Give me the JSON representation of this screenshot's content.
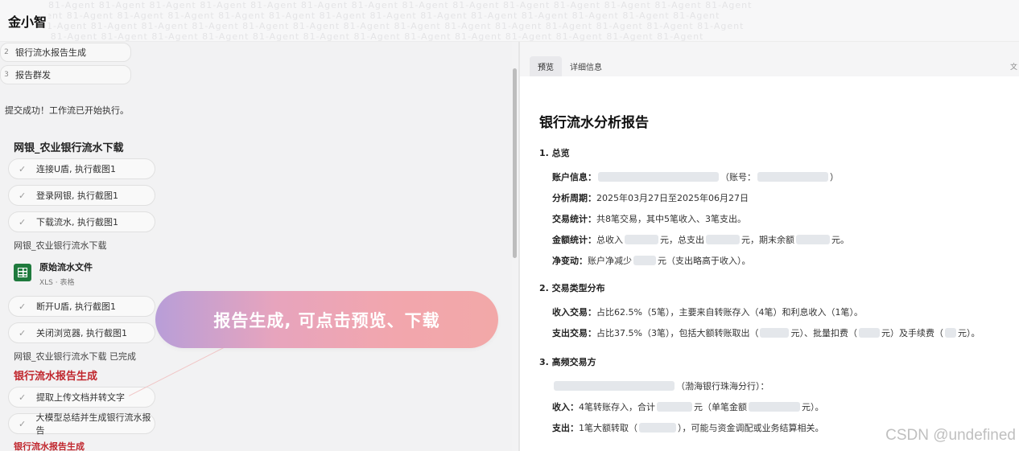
{
  "app": {
    "title": "金小智"
  },
  "watermark": {
    "text": "81-Agent 81-Agent 81-Agent 81-Agent 81-Agent 81-Agent 81-Agent 81-Agent 81-Agent 81-Agent 81-Agent 81-Agent 81-Agent 81-Agent"
  },
  "left": {
    "numbered_steps": [
      {
        "num": "2",
        "label": "银行流水报告生成"
      },
      {
        "num": "3",
        "label": "报告群发"
      }
    ],
    "submit_msg": "提交成功！工作流已开始执行。",
    "section1_title": "网银_农业银行流水下载",
    "section1_steps": [
      "连接U盾, 执行截图1",
      "登录网银, 执行截图1",
      "下载流水, 执行截图1"
    ],
    "section1_label": "网银_农业银行流水下载",
    "file": {
      "name": "原始流水文件",
      "type": "XLS · 表格"
    },
    "section1_steps_b": [
      "断开U盾, 执行截图1",
      "关闭浏览器, 执行截图1"
    ],
    "section1_done": "网银_农业银行流水下载 已完成",
    "section2_title": "银行流水报告生成",
    "section2_steps": [
      "提取上传文档并转文字",
      "大模型总结并生成银行流水报告"
    ],
    "section2_label": "银行流水报告生成",
    "check_icon": "check-icon",
    "file_icon": "spreadsheet-icon"
  },
  "banner": {
    "text": "报告生成, 可点击预览、下载"
  },
  "right": {
    "tabs": [
      "预览",
      "详细信息"
    ],
    "active_tab": "预览",
    "corner": "文",
    "report": {
      "title": "银行流水分析报告",
      "s1": "1. 总览",
      "account_label": "账户信息：",
      "account_no_label": "（账号：",
      "account_no_end": "）",
      "period_label": "分析周期：",
      "period_value": "2025年03月27日至2025年06月27日",
      "tx_label": "交易统计：",
      "tx_value": "共8笔交易，其中5笔收入、3笔支出。",
      "amt_label": "金额统计：",
      "amt_a": "总收入",
      "amt_b": "元，总支出",
      "amt_c": "元，期末余额",
      "amt_d": "元。",
      "net_label": "净变动：",
      "net_a": "账户净减少",
      "net_b": "元（支出略高于收入）。",
      "s2": "2. 交易类型分布",
      "in_label": "收入交易：",
      "in_value": "占比62.5%（5笔），主要来自转账存入（4笔）和利息收入（1笔）。",
      "out_label": "支出交易：",
      "out_a": "占比37.5%（3笔），包括大额转账取出（",
      "out_b": "元）、批量扣费（",
      "out_c": "元）及手续费（",
      "out_d": "元）。",
      "s3": "3. 高频交易方",
      "party_bank": "（渤海银行珠海分行）：",
      "inc_label": "收入：",
      "inc_a": "4笔转账存入，合计",
      "inc_b": "元（单笔金额",
      "inc_c": "元）。",
      "exp_label": "支出：",
      "exp_a": "1笔大额转取（",
      "exp_b": "），可能与资金调配或业务结算相关。"
    }
  },
  "csdn_watermark": "CSDN @undefined"
}
